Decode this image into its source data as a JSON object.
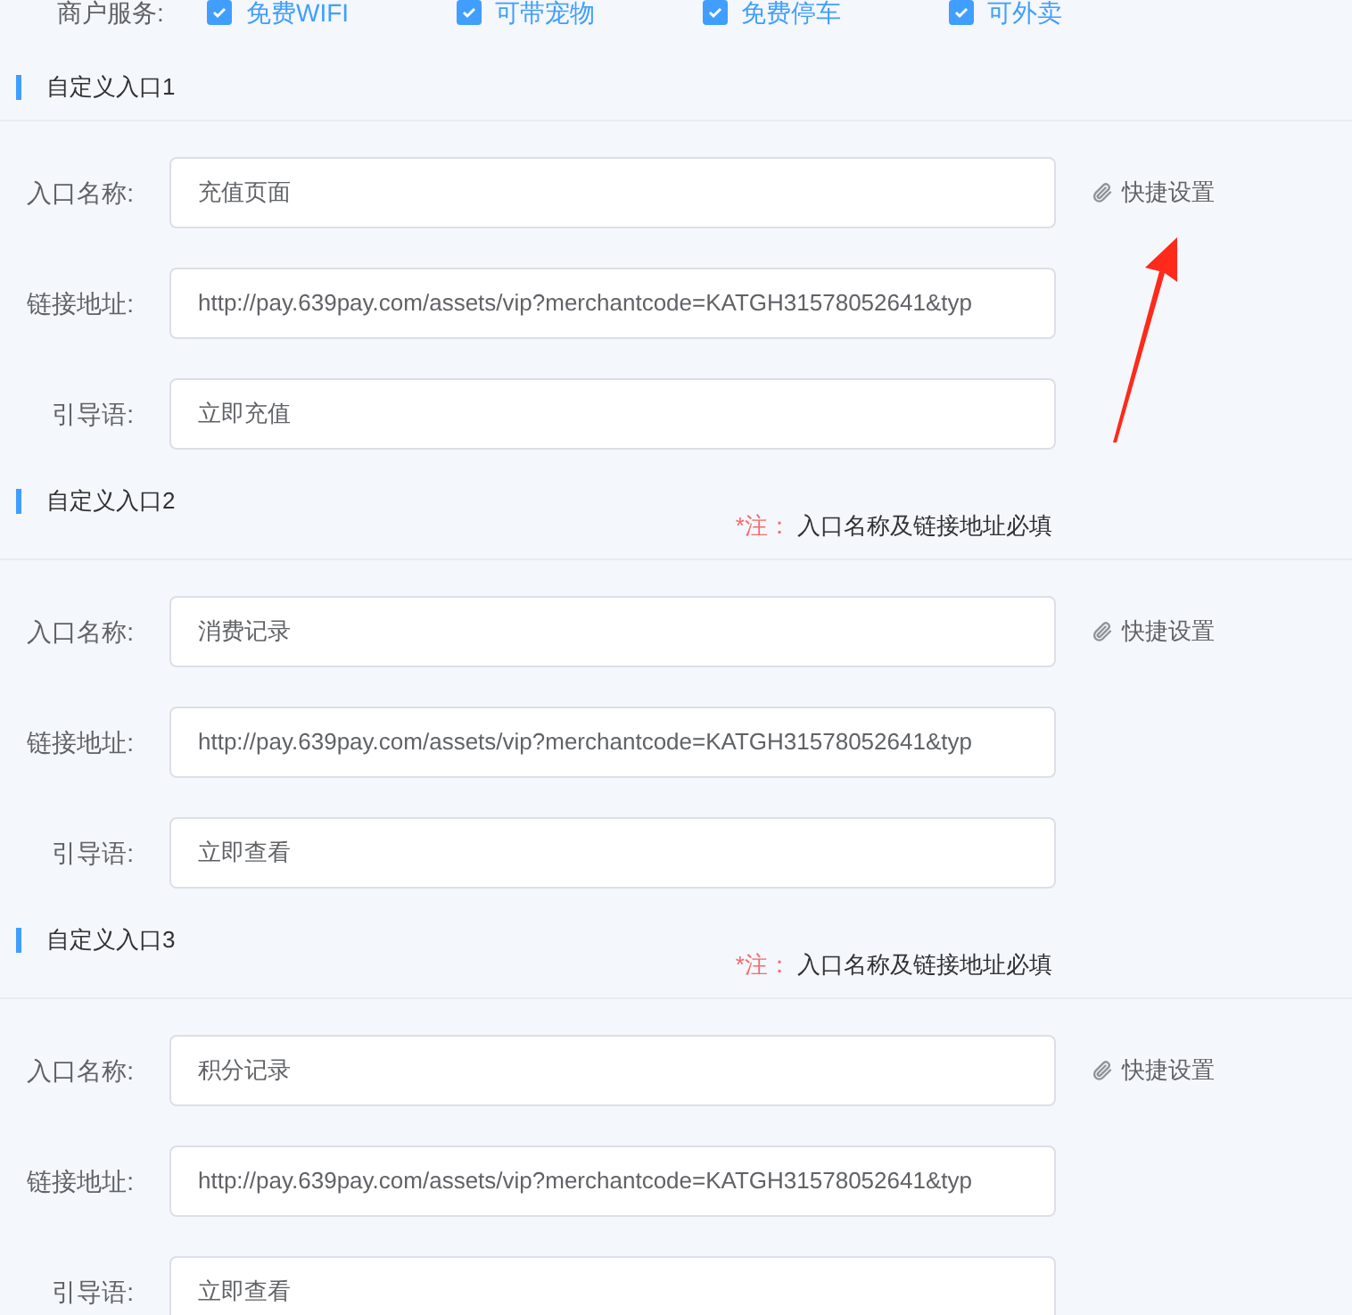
{
  "services": {
    "label": "商户服务:",
    "options": [
      {
        "label": "免费WIFI",
        "checked": true
      },
      {
        "label": "可带宠物",
        "checked": true
      },
      {
        "label": "免费停车",
        "checked": true
      },
      {
        "label": "可外卖",
        "checked": true
      }
    ]
  },
  "sections": [
    {
      "title": "自定义入口1",
      "fields": [
        {
          "label": "入口名称:",
          "value": "充值页面"
        },
        {
          "label": "链接地址:",
          "value": "http://pay.639pay.com/assets/vip?merchantcode=KATGH31578052641&typ"
        },
        {
          "label": "引导语:",
          "value": "立即充值"
        }
      ],
      "quick_setting": "快捷设置"
    },
    {
      "title": "自定义入口2",
      "note": {
        "mark": "*注：",
        "text": "入口名称及链接地址必填"
      },
      "fields": [
        {
          "label": "入口名称:",
          "value": "消费记录"
        },
        {
          "label": "链接地址:",
          "value": "http://pay.639pay.com/assets/vip?merchantcode=KATGH31578052641&typ"
        },
        {
          "label": "引导语:",
          "value": "立即查看"
        }
      ],
      "quick_setting": "快捷设置"
    },
    {
      "title": "自定义入口3",
      "note": {
        "mark": "*注：",
        "text": "入口名称及链接地址必填"
      },
      "fields": [
        {
          "label": "入口名称:",
          "value": "积分记录"
        },
        {
          "label": "链接地址:",
          "value": "http://pay.639pay.com/assets/vip?merchantcode=KATGH31578052641&typ"
        },
        {
          "label": "引导语:",
          "value": "立即查看"
        }
      ],
      "quick_setting": "快捷设置"
    }
  ]
}
